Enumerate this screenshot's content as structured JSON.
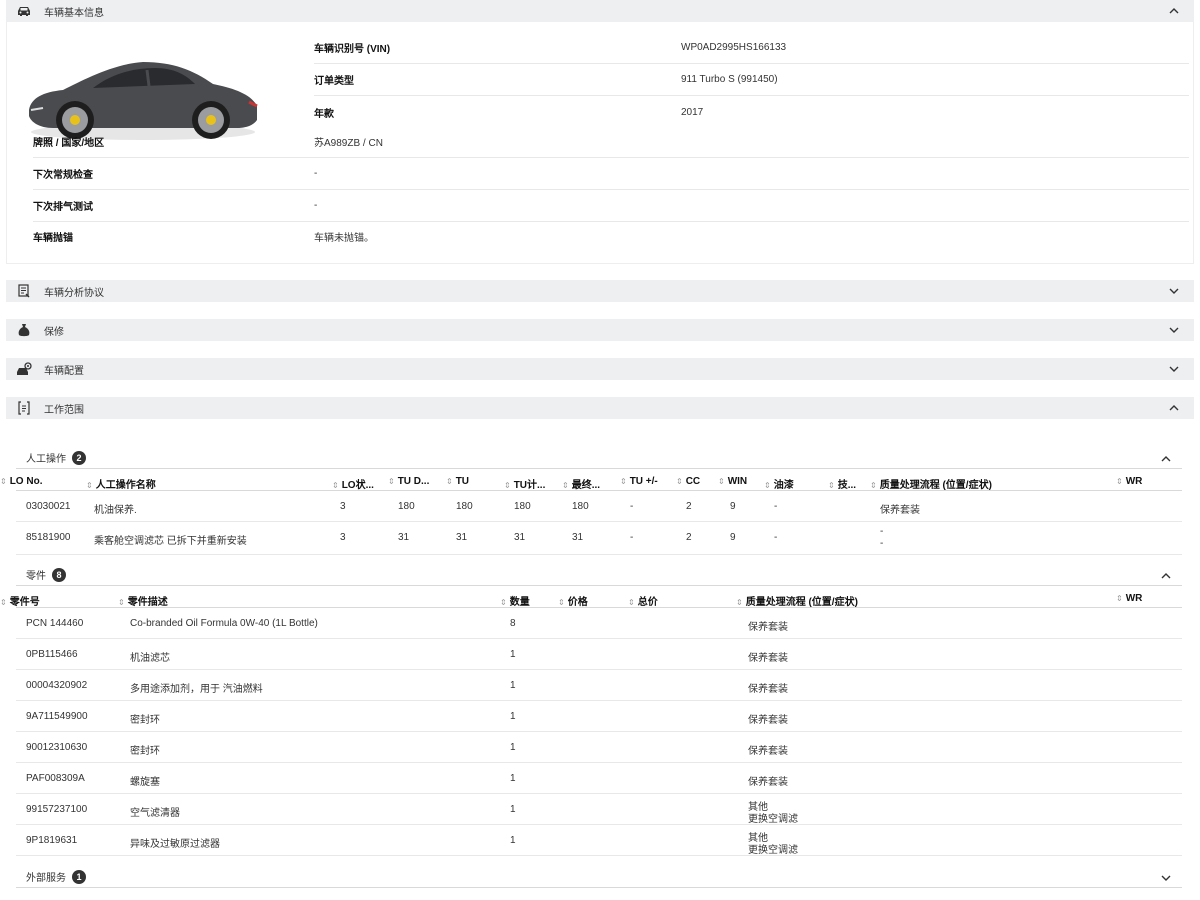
{
  "vehicle_info": {
    "title": "车辆基本信息",
    "fields": [
      {
        "label": "车辆识别号 (VIN)",
        "value": "WP0AD2995HS166133"
      },
      {
        "label": "订单类型",
        "value": "911 Turbo S (991450)"
      },
      {
        "label": "年款",
        "value": "2017"
      },
      {
        "label": "牌照 / 国家/地区",
        "value": "苏A989ZB / CN"
      },
      {
        "label": "下次常规检查",
        "value": "-"
      },
      {
        "label": "下次排气测试",
        "value": "-"
      },
      {
        "label": "车辆抛锚",
        "value": "车辆未抛锚。"
      }
    ]
  },
  "sections": [
    {
      "title": "车辆分析协议",
      "icon": "report-icon"
    },
    {
      "title": "保修",
      "icon": "warranty-bag-icon"
    },
    {
      "title": "车辆配置",
      "icon": "car-config-icon"
    },
    {
      "title": "工作范围",
      "icon": "work-scope-icon"
    }
  ],
  "labor": {
    "title": "人工操作",
    "count": "2",
    "headers": [
      "LO No.",
      "人工操作名称",
      "LO状...",
      "TU D...",
      "TU",
      "TU计...",
      "最终...",
      "TU +/-",
      "CC",
      "WIN",
      "油漆",
      "技...",
      "质量处理流程 (位置/症状)",
      "WR"
    ],
    "rows": [
      {
        "lo_no": "03030021",
        "name": "机油保养.",
        "lo_status": "3",
        "tu_d": "180",
        "tu": "180",
        "tu_calc": "180",
        "final": "180",
        "tu_pm": "-",
        "cc": "2",
        "win": "9",
        "paint": "-",
        "qp1": "保养套装",
        "qp2": ""
      },
      {
        "lo_no": "85181900",
        "name": "乘客舱空调滤芯 已拆下并重新安装",
        "lo_status": "3",
        "tu_d": "31",
        "tu": "31",
        "tu_calc": "31",
        "final": "31",
        "tu_pm": "-",
        "cc": "2",
        "win": "9",
        "paint": "-",
        "qp1": "-",
        "qp2": "-"
      }
    ]
  },
  "parts": {
    "title": "零件",
    "count": "8",
    "headers": [
      "零件号",
      "零件描述",
      "数量",
      "价格",
      "总价",
      "质量处理流程 (位置/症状)",
      "WR"
    ],
    "rows": [
      {
        "no": "PCN 144460",
        "desc": "Co-branded Oil Formula 0W-40 (1L Bottle)",
        "qty": "8",
        "qp1": "保养套装",
        "qp2": ""
      },
      {
        "no": "0PB115466",
        "desc": "机油滤芯",
        "qty": "1",
        "qp1": "保养套装",
        "qp2": ""
      },
      {
        "no": "00004320902",
        "desc": "多用途添加剂，用于 汽油燃料",
        "qty": "1",
        "qp1": "保养套装",
        "qp2": ""
      },
      {
        "no": "9A711549900",
        "desc": "密封环",
        "qty": "1",
        "qp1": "保养套装",
        "qp2": ""
      },
      {
        "no": "90012310630",
        "desc": "密封环",
        "qty": "1",
        "qp1": "保养套装",
        "qp2": ""
      },
      {
        "no": "PAF008309A",
        "desc": "螺旋塞",
        "qty": "1",
        "qp1": "保养套装",
        "qp2": ""
      },
      {
        "no": "99157237100",
        "desc": "空气滤清器",
        "qty": "1",
        "qp1": "其他",
        "qp2": "更换空调滤"
      },
      {
        "no": "9P1819631",
        "desc": "异味及过敏原过滤器",
        "qty": "1",
        "qp1": "其他",
        "qp2": "更换空调滤"
      }
    ]
  },
  "external_services": {
    "title": "外部服务",
    "count": "1"
  },
  "colors": {
    "section_bg": "#eeeff1",
    "badge_bg": "#333333",
    "car_body": "#4a4b4e",
    "brake_caliper": "#e8c21a"
  }
}
